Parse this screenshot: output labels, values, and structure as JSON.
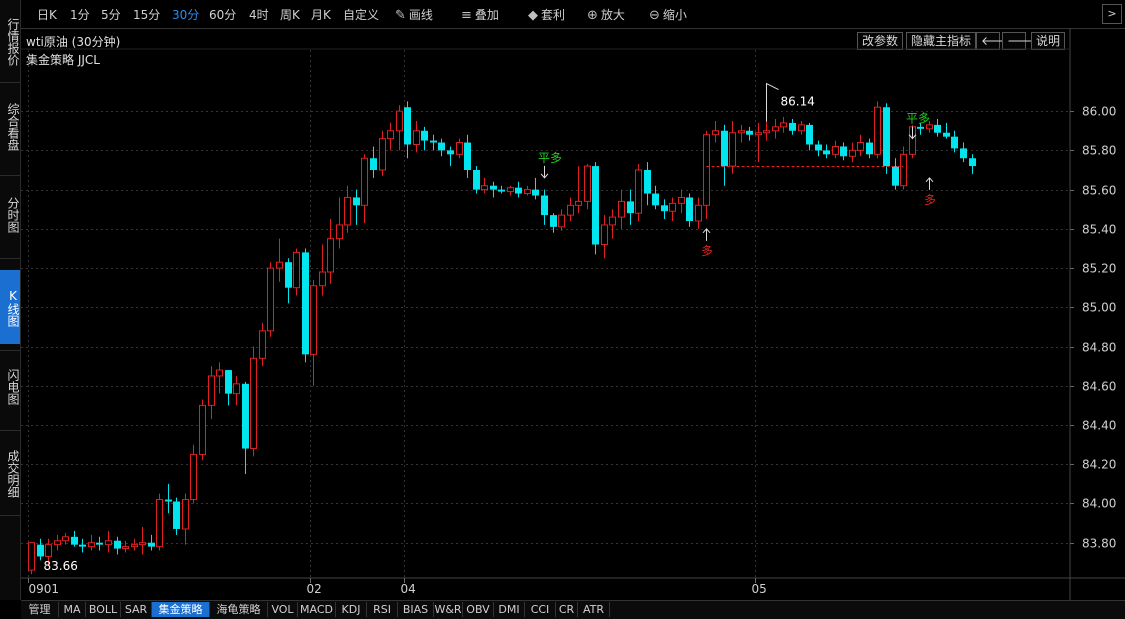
{
  "sidebar": {
    "tabs": [
      {
        "label": "行情报价",
        "active": false
      },
      {
        "label": "综合看盘",
        "active": false
      },
      {
        "label": "分时图",
        "active": false
      },
      {
        "label": "K线图",
        "active": true
      },
      {
        "label": "闪电图",
        "active": false
      },
      {
        "label": "成交明细",
        "active": false
      }
    ]
  },
  "toolbar": {
    "periods": [
      "日K",
      "1分",
      "5分",
      "15分",
      "30分",
      "60分",
      "4时",
      "周K",
      "月K",
      "自定义"
    ],
    "active_period": "30分",
    "draw_label": "画线",
    "overlay_label": "叠加",
    "arbitrage_label": "套利",
    "zoom_in_label": "放大",
    "zoom_out_label": "缩小"
  },
  "chart_title": "wti原油 (30分钟)",
  "strategy_label": "集金策略 JJCL",
  "buttons": {
    "change_params": "改参数",
    "hide_indicator": "隐藏主指标",
    "help": "说明"
  },
  "bottom_tabs": [
    "管理",
    "MA",
    "BOLL",
    "SAR",
    "集金策略",
    "海龟策略",
    "VOL",
    "MACD",
    "KDJ",
    "RSI",
    "BIAS",
    "W&R",
    "OBV",
    "DMI",
    "CCI",
    "CR",
    "ATR"
  ],
  "active_bottom_tab": "集金策略",
  "colors": {
    "up": "#e02020",
    "down": "#00e5ee",
    "signal_green": "#22cc22",
    "signal_red": "#e02020",
    "grid": "#333333",
    "text": "#d0d0d0"
  },
  "chart_data": {
    "type": "candlestick",
    "ylim": [
      83.62,
      86.22
    ],
    "yticks": [
      86.0,
      85.8,
      85.6,
      85.4,
      85.2,
      85.0,
      84.8,
      84.6,
      84.4,
      84.2,
      84.0,
      83.8
    ],
    "ytick_labels": [
      "86.00",
      "85.80",
      "85.60",
      "85.40",
      "85.20",
      "85.00",
      "84.80",
      "84.60",
      "84.40",
      "84.20",
      "84.00",
      "83.80"
    ],
    "xtick_labels": [
      {
        "index": 0,
        "label": "0901"
      },
      {
        "index": 33,
        "label": "02"
      },
      {
        "index": 44,
        "label": "04"
      },
      {
        "index": 85,
        "label": "05"
      }
    ],
    "candles": [
      [
        83.66,
        83.8,
        83.79,
        83.64
      ],
      [
        83.79,
        83.73,
        83.82,
        83.71
      ],
      [
        83.73,
        83.79,
        83.82,
        83.68
      ],
      [
        83.79,
        83.81,
        83.84,
        83.76
      ],
      [
        83.81,
        83.83,
        83.85,
        83.79
      ],
      [
        83.83,
        83.79,
        83.86,
        83.78
      ],
      [
        83.79,
        83.78,
        83.82,
        83.75
      ],
      [
        83.78,
        83.8,
        83.84,
        83.76
      ],
      [
        83.8,
        83.79,
        83.83,
        83.76
      ],
      [
        83.79,
        83.81,
        83.86,
        83.75
      ],
      [
        83.81,
        83.77,
        83.83,
        83.74
      ],
      [
        83.77,
        83.78,
        83.81,
        83.75
      ],
      [
        83.78,
        83.79,
        83.82,
        83.76
      ],
      [
        83.79,
        83.8,
        83.88,
        83.74
      ],
      [
        83.8,
        83.78,
        83.84,
        83.76
      ],
      [
        83.78,
        84.02,
        84.05,
        83.76
      ],
      [
        84.02,
        84.01,
        84.1,
        83.95
      ],
      [
        84.01,
        83.87,
        84.03,
        83.84
      ],
      [
        83.87,
        84.02,
        84.05,
        83.79
      ],
      [
        84.02,
        84.25,
        84.3,
        84.0
      ],
      [
        84.25,
        84.5,
        84.53,
        84.22
      ],
      [
        84.5,
        84.65,
        84.7,
        84.43
      ],
      [
        84.65,
        84.68,
        84.72,
        84.56
      ],
      [
        84.68,
        84.56,
        84.68,
        84.5
      ],
      [
        84.56,
        84.61,
        84.65,
        84.5
      ],
      [
        84.61,
        84.28,
        84.62,
        84.15
      ],
      [
        84.28,
        84.74,
        84.8,
        84.24
      ],
      [
        84.74,
        84.88,
        84.92,
        84.7
      ],
      [
        84.88,
        85.2,
        85.23,
        84.85
      ],
      [
        85.2,
        85.23,
        85.35,
        85.13
      ],
      [
        85.23,
        85.1,
        85.25,
        85.02
      ],
      [
        85.1,
        85.28,
        85.3,
        85.06
      ],
      [
        85.28,
        84.76,
        85.3,
        84.72
      ],
      [
        84.76,
        85.11,
        85.14,
        84.6
      ],
      [
        85.11,
        85.18,
        85.32,
        85.06
      ],
      [
        85.18,
        85.35,
        85.45,
        85.12
      ],
      [
        85.35,
        85.42,
        85.56,
        85.3
      ],
      [
        85.42,
        85.56,
        85.62,
        85.38
      ],
      [
        85.56,
        85.52,
        85.6,
        85.42
      ],
      [
        85.52,
        85.76,
        85.78,
        85.43
      ],
      [
        85.76,
        85.7,
        85.82,
        85.66
      ],
      [
        85.7,
        85.86,
        85.9,
        85.67
      ],
      [
        85.86,
        85.9,
        85.94,
        85.8
      ],
      [
        85.9,
        86.0,
        86.03,
        85.8
      ],
      [
        86.02,
        85.83,
        86.05,
        85.76
      ],
      [
        85.83,
        85.9,
        85.95,
        85.79
      ],
      [
        85.9,
        85.85,
        85.92,
        85.8
      ],
      [
        85.85,
        85.84,
        85.88,
        85.8
      ],
      [
        85.84,
        85.8,
        85.86,
        85.77
      ],
      [
        85.8,
        85.78,
        85.82,
        85.72
      ],
      [
        85.78,
        85.84,
        85.86,
        85.76
      ],
      [
        85.84,
        85.7,
        85.88,
        85.66
      ],
      [
        85.7,
        85.6,
        85.72,
        85.58
      ],
      [
        85.6,
        85.62,
        85.66,
        85.58
      ],
      [
        85.62,
        85.6,
        85.64,
        85.56
      ],
      [
        85.6,
        85.59,
        85.62,
        85.58
      ],
      [
        85.59,
        85.61,
        85.62,
        85.57
      ],
      [
        85.61,
        85.58,
        85.64,
        85.56
      ],
      [
        85.58,
        85.6,
        85.62,
        85.57
      ],
      [
        85.6,
        85.57,
        85.66,
        85.55
      ],
      [
        85.57,
        85.47,
        85.6,
        85.42
      ],
      [
        85.47,
        85.41,
        85.48,
        85.38
      ],
      [
        85.41,
        85.47,
        85.5,
        85.39
      ],
      [
        85.47,
        85.52,
        85.56,
        85.44
      ],
      [
        85.52,
        85.54,
        85.72,
        85.48
      ],
      [
        85.54,
        85.72,
        85.73,
        85.5
      ],
      [
        85.72,
        85.32,
        85.74,
        85.27
      ],
      [
        85.32,
        85.42,
        85.47,
        85.25
      ],
      [
        85.42,
        85.46,
        85.5,
        85.35
      ],
      [
        85.46,
        85.54,
        85.6,
        85.4
      ],
      [
        85.54,
        85.48,
        85.6,
        85.42
      ],
      [
        85.48,
        85.7,
        85.73,
        85.44
      ],
      [
        85.7,
        85.58,
        85.74,
        85.52
      ],
      [
        85.58,
        85.52,
        85.62,
        85.5
      ],
      [
        85.52,
        85.49,
        85.55,
        85.45
      ],
      [
        85.49,
        85.53,
        85.56,
        85.44
      ],
      [
        85.53,
        85.56,
        85.6,
        85.48
      ],
      [
        85.56,
        85.44,
        85.58,
        85.41
      ],
      [
        85.44,
        85.52,
        85.56,
        85.4
      ],
      [
        85.52,
        85.88,
        85.9,
        85.45
      ],
      [
        85.88,
        85.9,
        85.95,
        85.84
      ],
      [
        85.9,
        85.72,
        85.93,
        85.62
      ],
      [
        85.72,
        85.89,
        85.95,
        85.68
      ],
      [
        85.89,
        85.9,
        85.93,
        85.84
      ],
      [
        85.9,
        85.88,
        85.92,
        85.85
      ],
      [
        85.88,
        85.89,
        85.94,
        85.74
      ],
      [
        85.89,
        85.9,
        86.1,
        85.85
      ],
      [
        85.9,
        85.92,
        85.96,
        85.86
      ],
      [
        85.92,
        85.94,
        85.97,
        85.89
      ],
      [
        85.94,
        85.9,
        85.96,
        85.88
      ],
      [
        85.9,
        85.93,
        85.95,
        85.88
      ],
      [
        85.93,
        85.83,
        85.94,
        85.8
      ],
      [
        85.83,
        85.8,
        85.85,
        85.77
      ],
      [
        85.8,
        85.78,
        85.83,
        85.76
      ],
      [
        85.78,
        85.82,
        85.85,
        85.76
      ],
      [
        85.82,
        85.77,
        85.84,
        85.75
      ],
      [
        85.77,
        85.8,
        85.84,
        85.74
      ],
      [
        85.8,
        85.84,
        85.88,
        85.77
      ],
      [
        85.84,
        85.78,
        85.86,
        85.76
      ],
      [
        85.78,
        86.02,
        86.05,
        85.76
      ],
      [
        86.02,
        85.72,
        86.04,
        85.68
      ],
      [
        85.72,
        85.62,
        85.76,
        85.6
      ],
      [
        85.62,
        85.78,
        85.82,
        85.6
      ],
      [
        85.78,
        85.92,
        85.93,
        85.76
      ],
      [
        85.92,
        85.91,
        85.94,
        85.88
      ],
      [
        85.91,
        85.93,
        85.95,
        85.89
      ],
      [
        85.93,
        85.89,
        85.96,
        85.87
      ],
      [
        85.89,
        85.87,
        85.94,
        85.86
      ],
      [
        85.87,
        85.81,
        85.9,
        85.79
      ],
      [
        85.81,
        85.76,
        85.84,
        85.74
      ],
      [
        85.76,
        85.72,
        85.78,
        85.68
      ]
    ],
    "annotations": {
      "high_label": "86.14",
      "low_label": "83.66",
      "signals": [
        {
          "text": "平多",
          "type": "close_long",
          "index": 60,
          "price": 85.66
        },
        {
          "text": "多",
          "type": "long",
          "index": 79,
          "price": 85.4
        },
        {
          "text": "平多",
          "type": "close_long",
          "index": 103,
          "price": 85.86
        },
        {
          "text": "多",
          "type": "long",
          "index": 105,
          "price": 85.66
        }
      ],
      "dashed_line": {
        "from_index": 79,
        "to_index": 102,
        "price": 85.72
      }
    }
  }
}
